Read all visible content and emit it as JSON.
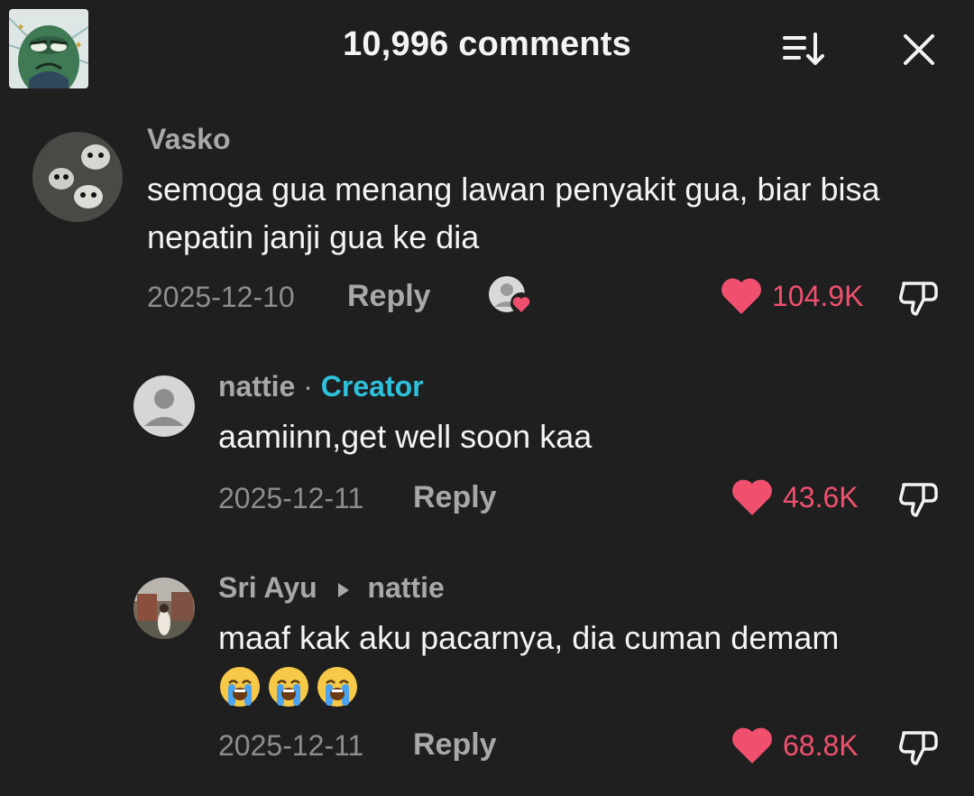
{
  "header": {
    "title": "10,996 comments",
    "sort_icon": "sort-down-icon",
    "close_icon": "close-icon"
  },
  "colors": {
    "background": "#1f1f1f",
    "accent_like": "#f0506e",
    "creator": "#2ec1dc",
    "muted": "#a8a8a8"
  },
  "comments": [
    {
      "username": "Vasko",
      "text": "semoga gua menang lawan penyakit gua, biar bisa nepatin janji gua ke dia",
      "date": "2025-12-10",
      "reply_label": "Reply",
      "likes": "104.9K",
      "creator_liked": true
    },
    {
      "username": "nattie",
      "separator": "·",
      "badge": "Creator",
      "text": "aamiinn,get well soon kaa",
      "date": "2025-12-11",
      "reply_label": "Reply",
      "likes": "43.6K"
    },
    {
      "username": "Sri Ayu",
      "reply_to": "nattie",
      "text": "maaf kak aku pacarnya, dia cuman demam",
      "emojis": [
        "loudly-crying-face",
        "loudly-crying-face",
        "loudly-crying-face"
      ],
      "date": "2025-12-11",
      "reply_label": "Reply",
      "likes": "68.8K"
    }
  ]
}
